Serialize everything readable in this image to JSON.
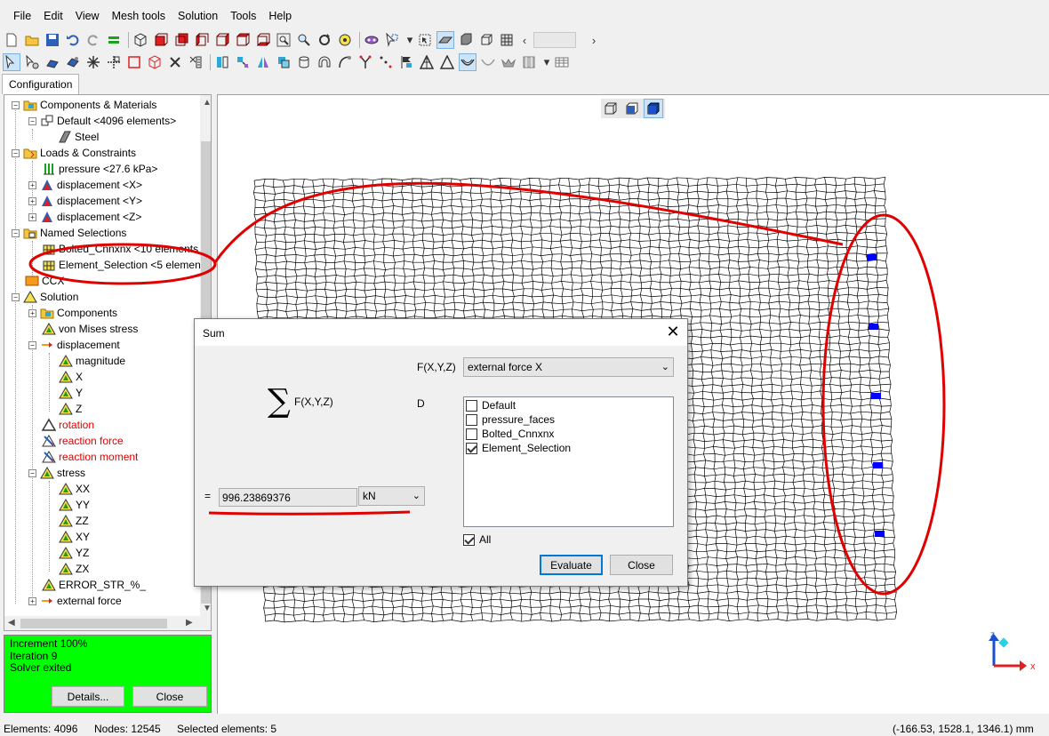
{
  "menu": [
    "File",
    "Edit",
    "View",
    "Mesh tools",
    "Solution",
    "Tools",
    "Help"
  ],
  "toolbar1_icons": [
    "new-icon",
    "open-icon",
    "save-icon",
    "undo-icon",
    "redo-icon",
    "equals-icon",
    "sep",
    "cube-icon",
    "cube-red-front-icon",
    "cube-red-back-icon",
    "cube-red-left-icon",
    "cube-red-right-icon",
    "cube-red-top-icon",
    "cube-red-bottom-icon",
    "zoom-box-icon",
    "zoom-icon",
    "rotate-icon",
    "pan-icon",
    "sep",
    "mask-icon",
    "pointer-dropdown-icon",
    "select-icon",
    "surface-icon",
    "solid-icon",
    "wireframe-icon",
    "wire-mesh-icon"
  ],
  "config_tab": "Configuration",
  "tree": {
    "components_materials": "Components & Materials",
    "default": "Default <4096 elements>",
    "steel": "Steel",
    "loads": "Loads & Constraints",
    "pressure": "pressure <27.6 kPa>",
    "disp_x": "displacement <X>",
    "disp_y": "displacement <Y>",
    "disp_z": "displacement <Z>",
    "named": "Named Selections",
    "bolted": "Bolted_Cnnxnx <10 elements",
    "element_sel": "Element_Selection <5 elemen",
    "ccx": "CCX",
    "solution": "Solution",
    "components": "Components",
    "von_mises": "von Mises stress",
    "displacement": "displacement",
    "magnitude": "magnitude",
    "x": "X",
    "y": "Y",
    "z": "Z",
    "rotation": "rotation",
    "reaction_force": "reaction force",
    "reaction_moment": "reaction moment",
    "stress": "stress",
    "xx": "XX",
    "yy": "YY",
    "zz": "ZZ",
    "xy": "XY",
    "yz": "YZ",
    "zx": "ZX",
    "error": "ERROR_STR_%_",
    "external_force": "external force"
  },
  "solver": {
    "increment": "Increment 100%",
    "iteration": "Iteration 9",
    "status": "Solver exited",
    "details_label": "Details...",
    "close_label": "Close"
  },
  "dialog": {
    "title": "Sum",
    "sigma": "∑",
    "formula": "F(X,Y,Z)",
    "fxyz_label": "F(X,Y,Z)",
    "fxyz_value": "external force X",
    "d_label": "D",
    "equals": "=",
    "result": "996.23869376",
    "unit": "kN",
    "sets": [
      {
        "name": "Default",
        "checked": false
      },
      {
        "name": "pressure_faces",
        "checked": false
      },
      {
        "name": "Bolted_Cnnxnx",
        "checked": false
      },
      {
        "name": "Element_Selection",
        "checked": true
      }
    ],
    "all_label": "All",
    "all_checked": true,
    "evaluate_label": "Evaluate",
    "close_label": "Close"
  },
  "axes": {
    "x": "x",
    "z": "z"
  },
  "statusbar": {
    "elements": "Elements: 4096",
    "nodes": "Nodes: 12545",
    "selected": "Selected elements: 5",
    "coords": "(-166.53, 1528.1, 1346.1) mm"
  },
  "colors": {
    "solver_bg": "#00ff00",
    "annotation": "#e00000",
    "selected_element": "#0000ff",
    "red_label": "#e00000"
  }
}
